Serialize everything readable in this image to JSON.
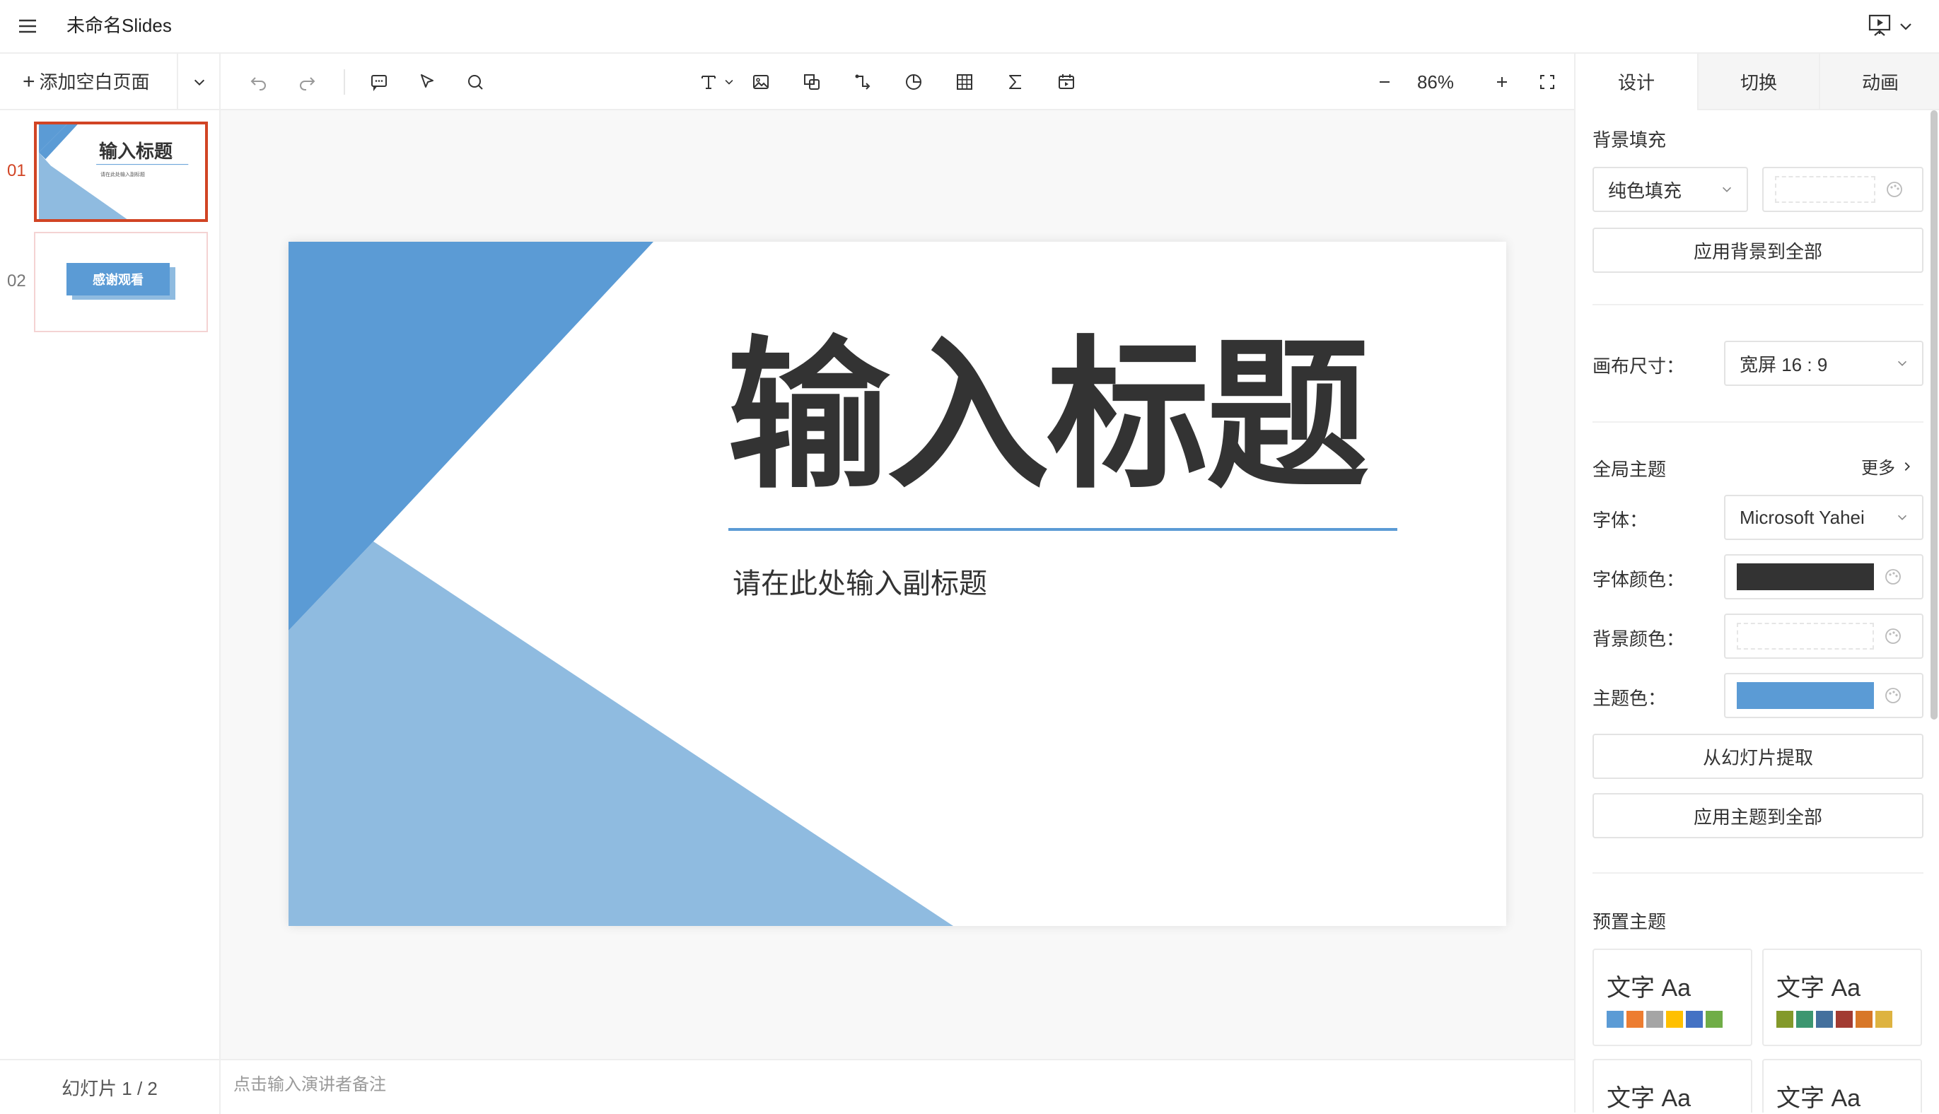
{
  "app": {
    "title": "未命名Slides"
  },
  "left_actions": {
    "add_page_label": "添加空白页面"
  },
  "toolbar": {
    "zoom": "86%"
  },
  "thumbnails": [
    {
      "num": "01",
      "title": "输入标题",
      "subtitle": "请在此处输入副标题",
      "active": true
    },
    {
      "num": "02",
      "title": "感谢观看",
      "active": false
    }
  ],
  "slide": {
    "title": "输入标题",
    "subtitle": "请在此处输入副标题",
    "colors": {
      "triangle_dark": "#5b9bd5",
      "triangle_light": "#8fbbe0",
      "line": "#5b9bd5",
      "text": "#333333"
    }
  },
  "bottom": {
    "slide_counter": "幻灯片 1 / 2",
    "notes_placeholder": "点击输入演讲者备注"
  },
  "right_panel": {
    "tabs": [
      {
        "label": "设计",
        "active": true
      },
      {
        "label": "切换",
        "active": false
      },
      {
        "label": "动画",
        "active": false
      }
    ],
    "background_fill": {
      "heading": "背景填充",
      "type_value": "纯色填充",
      "apply_all_label": "应用背景到全部"
    },
    "canvas_size": {
      "label": "画布尺寸：",
      "value": "宽屏 16 : 9"
    },
    "global_theme": {
      "heading": "全局主题",
      "more_label": "更多",
      "font_label": "字体：",
      "font_value": "Microsoft Yahei",
      "font_color_label": "字体颜色：",
      "font_color": "#333333",
      "bg_color_label": "背景颜色：",
      "theme_color_label": "主题色：",
      "theme_color": "#5b9bd5",
      "extract_label": "从幻灯片提取",
      "apply_theme_label": "应用主题到全部"
    },
    "preset_themes": {
      "heading": "预置主题",
      "items": [
        {
          "text": "文字 Aa",
          "colors": [
            "#5b9bd5",
            "#ed7d31",
            "#a5a5a5",
            "#ffc000",
            "#4472c4",
            "#70ad47"
          ]
        },
        {
          "text": "文字 Aa",
          "colors": [
            "#83992a",
            "#3c9670",
            "#44709d",
            "#a23b32",
            "#d87728",
            "#deb340"
          ]
        },
        {
          "text": "文字 Aa",
          "colors": []
        },
        {
          "text": "文字 Aa",
          "colors": []
        }
      ]
    }
  }
}
